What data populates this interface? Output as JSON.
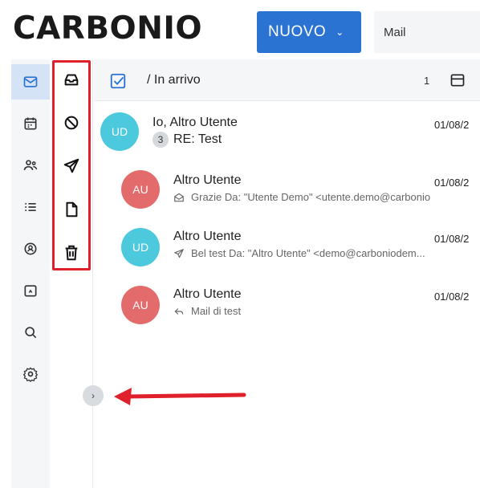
{
  "app": {
    "logo": "CARBONIO"
  },
  "header": {
    "new_button": "NUOVO",
    "search_scope": "Mail"
  },
  "rail": {
    "items": [
      {
        "icon": "mail-icon",
        "active": true
      },
      {
        "icon": "calendar-icon",
        "active": false
      },
      {
        "icon": "contacts-icon",
        "active": false
      },
      {
        "icon": "tasks-icon",
        "active": false
      },
      {
        "icon": "chats-icon",
        "active": false
      },
      {
        "icon": "files-icon",
        "active": false
      },
      {
        "icon": "search-icon",
        "active": false
      },
      {
        "icon": "settings-icon",
        "active": false
      }
    ]
  },
  "folders": {
    "items": [
      {
        "icon": "inbox-icon"
      },
      {
        "icon": "spam-icon"
      },
      {
        "icon": "sent-icon"
      },
      {
        "icon": "drafts-icon"
      },
      {
        "icon": "trash-icon"
      }
    ]
  },
  "list": {
    "path": "/ In arrivo",
    "count": "1"
  },
  "messages": [
    {
      "initials": "UD",
      "color": "#4dc9de",
      "sender": "Io, Altro Utente",
      "date": "01/08/2",
      "thread_count": "3",
      "subject": "RE: Test",
      "type": "thread"
    },
    {
      "initials": "AU",
      "color": "#e36b6b",
      "sender": "Altro Utente",
      "date": "01/08/2",
      "subject": "Grazie Da: \"Utente Demo\" <utente.demo@carbonio",
      "icon": "envelope-open-icon",
      "type": "child"
    },
    {
      "initials": "UD",
      "color": "#4dc9de",
      "sender": "Altro Utente",
      "date": "01/08/2",
      "subject": "Bel test Da: \"Altro Utente\" <demo@carboniodem...",
      "icon": "sent-icon",
      "type": "child"
    },
    {
      "initials": "AU",
      "color": "#e36b6b",
      "sender": "Altro Utente",
      "date": "01/08/2",
      "subject": "Mail di test",
      "icon": "reply-icon",
      "type": "child"
    }
  ],
  "colors": {
    "accent": "#2b73d2",
    "highlight": "#e0202a"
  }
}
